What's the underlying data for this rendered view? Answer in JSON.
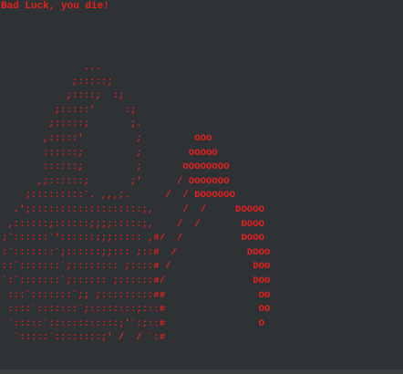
{
  "message": "Bad Luck, you die!",
  "art": "              ...\n            ;:::::;\n           ;::::;  :;\n         ;:::::'     :;\n        ;:::::;       ;.\n       ,:::::'         ;         OOO\n       ::::::;         ;        OOOOO\n       ::::::;         ;       OOOOOOOO\n      ,;::::::;       ;'      / OOOOOOO\n    ;:::::::::`. ,,,;.      /  / DOOOOOO\n  .';:::::::::::::::::::;,     /  /     DOOOO\n ,::::::;::::::;;;;:::::;,    /  /       DOOO\n;`::::::`'::::::;;;::::: ,#/  /          DOOO\n:`:::::::`;::::::;;::: ;::#  /            DOOO\n::`:::::::`;:::::::: ;::::# /              DOO\n`:`:::::::`;:::::: ;::::::#/               DOO\n :::`:::::::`;; ;:::::::::##                OO\n ::::`:::::::`;::::::::;:::#                OO\n `:::::`::::::::::::;'`:;::#                O\n  `:::::`::::::::;' /  / `:#"
}
